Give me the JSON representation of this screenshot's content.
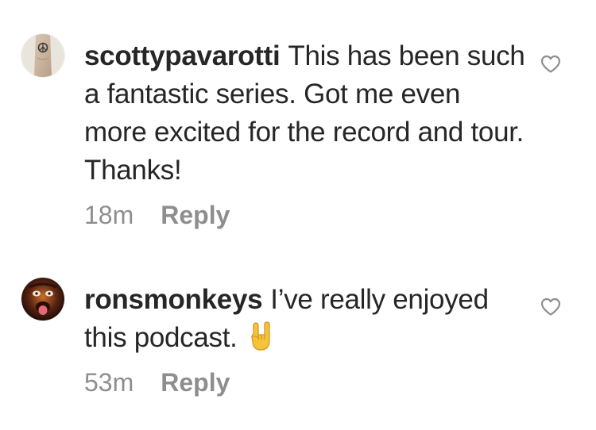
{
  "comments": [
    {
      "username": "scottypavarotti",
      "text": "This has been such a fantastic series. Got me even more excited for the record and tour. Thanks!",
      "time": "18m",
      "reply_label": "Reply",
      "avatar_icon": "avatar-tattooed-arm"
    },
    {
      "username": "ronsmonkeys",
      "text": "I’ve really enjoyed this podcast.",
      "emoji": "sign-of-the-horns",
      "time": "53m",
      "reply_label": "Reply",
      "avatar_icon": "avatar-face-tongue-out"
    }
  ],
  "colors": {
    "text": "#262626",
    "secondary": "#8e8e8e",
    "heart_outline": "#8e8e8e"
  }
}
